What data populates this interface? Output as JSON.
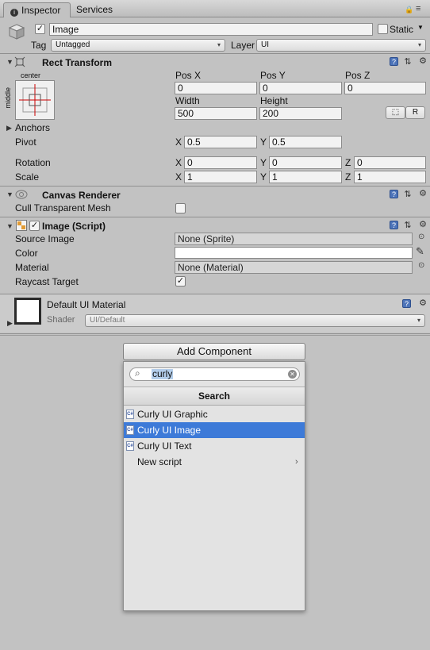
{
  "tabs": [
    {
      "label": "Inspector",
      "active": true
    },
    {
      "label": "Services",
      "active": false
    }
  ],
  "object": {
    "name": "Image",
    "active_checked": true,
    "static_label": "Static",
    "static_checked": false,
    "tag_label": "Tag",
    "tag_value": "Untagged",
    "layer_label": "Layer",
    "layer_value": "UI"
  },
  "rect_transform": {
    "title": "Rect Transform",
    "anchor_preset": {
      "horizontal": "center",
      "vertical": "middle"
    },
    "pos_x_label": "Pos X",
    "pos_y_label": "Pos Y",
    "pos_z_label": "Pos Z",
    "pos_x": "0",
    "pos_y": "0",
    "pos_z": "0",
    "width_label": "Width",
    "height_label": "Height",
    "width": "500",
    "height": "200",
    "blueprint_btn": "⬚",
    "raw_btn": "R",
    "anchors_label": "Anchors",
    "pivot_label": "Pivot",
    "pivot_x": "0.5",
    "pivot_y": "0.5",
    "rotation_label": "Rotation",
    "rot_x": "0",
    "rot_y": "0",
    "rot_z": "0",
    "scale_label": "Scale",
    "scale_x": "1",
    "scale_y": "1",
    "scale_z": "1",
    "axis_x": "X",
    "axis_y": "Y",
    "axis_z": "Z"
  },
  "canvas_renderer": {
    "title": "Canvas Renderer",
    "cull_label": "Cull Transparent Mesh",
    "cull_checked": false
  },
  "image_script": {
    "title": "Image (Script)",
    "enabled": true,
    "source_image_label": "Source Image",
    "source_image_value": "None (Sprite)",
    "color_label": "Color",
    "color_value": "#ffffff",
    "material_label": "Material",
    "material_value": "None (Material)",
    "raycast_label": "Raycast Target",
    "raycast_checked": true
  },
  "material": {
    "title": "Default UI Material",
    "shader_label": "Shader",
    "shader_value": "UI/Default"
  },
  "add_component": {
    "button_label": "Add Component",
    "search_value": "curly",
    "popup_title": "Search",
    "items": [
      {
        "label": "Curly UI Graphic",
        "icon": "csharp-script-icon",
        "selected": false
      },
      {
        "label": "Curly UI Image",
        "icon": "csharp-script-icon",
        "selected": true
      },
      {
        "label": "Curly UI Text",
        "icon": "csharp-script-icon",
        "selected": false
      },
      {
        "label": "New script",
        "icon": "",
        "selected": false,
        "submenu": true
      }
    ]
  },
  "colors": {
    "selection": "#3d7ad8",
    "help_icon": "#4d74b9",
    "panel_bg": "#c2c2c2"
  }
}
